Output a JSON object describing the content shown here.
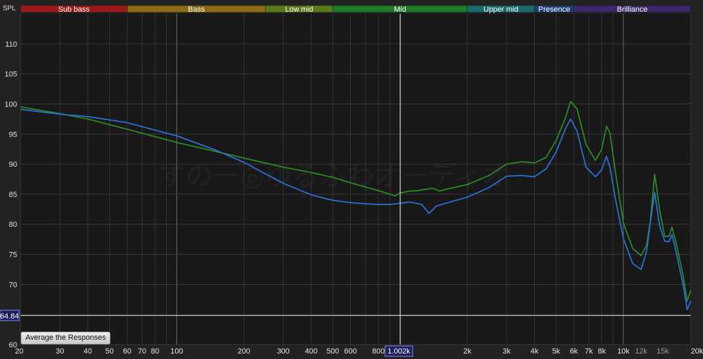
{
  "frequency_bands": [
    {
      "label": "Sub bass",
      "from": 20,
      "to": 60,
      "color": "#9a1a1a"
    },
    {
      "label": "Bass",
      "from": 60,
      "to": 250,
      "color": "#8a6a14"
    },
    {
      "label": "Low mid",
      "from": 250,
      "to": 500,
      "color": "#5a7a1a"
    },
    {
      "label": "Mid",
      "from": 500,
      "to": 2000,
      "color": "#1f7a2a"
    },
    {
      "label": "Upper mid",
      "from": 2000,
      "to": 4000,
      "color": "#1c6a6a"
    },
    {
      "label": "Presence",
      "from": 4000,
      "to": 6000,
      "color": "#1f3f7a"
    },
    {
      "label": "Brilliance",
      "from": 6000,
      "to": 20000,
      "color": "#3a2a6a"
    }
  ],
  "watermark": "すの一◎ゆるふわオーディオ",
  "cursor": {
    "x_label": "1.002k",
    "y_label": "64.84"
  },
  "controls": {
    "average_button": "Average the Responses"
  },
  "chart_data": {
    "type": "line",
    "ylabel": "SPL",
    "x_scale": "log",
    "xlim": [
      20,
      20000
    ],
    "ylim": [
      60,
      115
    ],
    "yticks": [
      60,
      65,
      70,
      75,
      80,
      85,
      90,
      95,
      100,
      105,
      110
    ],
    "ytick_labels": [
      "60",
      "",
      "70",
      "75",
      "80",
      "85",
      "90",
      "95",
      "100",
      "105",
      "110"
    ],
    "xticks": [
      20,
      30,
      40,
      50,
      60,
      70,
      80,
      100,
      200,
      300,
      400,
      500,
      600,
      800,
      2000,
      3000,
      4000,
      5000,
      6000,
      7000,
      8000,
      10000,
      12000,
      15000,
      20000
    ],
    "xtick_labels": [
      "20",
      "30",
      "40",
      "50",
      "60",
      "70",
      "80",
      "100",
      "200",
      "300",
      "400",
      "500",
      "600",
      "800",
      "2k",
      "3k",
      "4k",
      "5k",
      "6k",
      "7k",
      "8k",
      "10k",
      "12k",
      "15k",
      "20kHz"
    ],
    "dim_xtick_labels": [
      "12k",
      "15k"
    ],
    "grid": true,
    "series": [
      {
        "color": "#2a8a2a",
        "x": [
          20,
          30,
          40,
          60,
          100,
          150,
          200,
          300,
          400,
          500,
          600,
          700,
          800,
          900,
          950,
          1000,
          1100,
          1200,
          1400,
          1500,
          1600,
          2000,
          2500,
          3000,
          3500,
          4000,
          4500,
          5000,
          5500,
          5800,
          6200,
          6800,
          7500,
          8000,
          8400,
          8700,
          9200,
          10000,
          11000,
          12000,
          12700,
          13200,
          13800,
          14500,
          15300,
          16000,
          16500,
          17200,
          18500,
          19300,
          20000
        ],
        "y": [
          99.5,
          98.4,
          97.5,
          95.8,
          93.6,
          92.1,
          91.0,
          89.5,
          88.6,
          87.8,
          86.9,
          86.2,
          85.6,
          85.0,
          84.7,
          85.2,
          85.5,
          85.6,
          86.0,
          85.5,
          85.8,
          86.6,
          88.1,
          90.0,
          90.4,
          90.2,
          91.1,
          93.9,
          97.7,
          100.4,
          99.2,
          93.3,
          90.6,
          92.5,
          96.3,
          95.2,
          88.8,
          80.2,
          76.0,
          74.8,
          76.5,
          80.5,
          88.3,
          82.5,
          78.0,
          78.0,
          79.5,
          77.0,
          71.5,
          67.2,
          69.0
        ]
      },
      {
        "color": "#2b6fd6",
        "x": [
          20,
          30,
          40,
          60,
          100,
          150,
          200,
          300,
          400,
          450,
          500,
          600,
          700,
          800,
          900,
          1000,
          1100,
          1250,
          1350,
          1450,
          1600,
          2000,
          2500,
          3000,
          3500,
          4000,
          4500,
          5000,
          5500,
          5800,
          6200,
          6800,
          7500,
          8000,
          8400,
          8700,
          9200,
          10000,
          11000,
          12000,
          12700,
          13200,
          13800,
          14500,
          15300,
          16000,
          16500,
          17200,
          18500,
          19300,
          20000
        ],
        "y": [
          99.1,
          98.3,
          97.9,
          96.9,
          94.7,
          92.3,
          90.3,
          86.8,
          84.9,
          84.4,
          84.0,
          83.6,
          83.4,
          83.3,
          83.3,
          83.5,
          83.7,
          83.3,
          81.8,
          83.0,
          83.5,
          84.5,
          86.1,
          88.0,
          88.1,
          87.9,
          89.2,
          92.0,
          95.9,
          97.5,
          95.5,
          89.5,
          87.9,
          89.1,
          91.3,
          89.5,
          84.3,
          77.6,
          73.5,
          72.5,
          75.5,
          80.3,
          85.3,
          79.8,
          77.2,
          77.1,
          78.3,
          75.5,
          70.0,
          65.8,
          67.2
        ]
      }
    ]
  }
}
